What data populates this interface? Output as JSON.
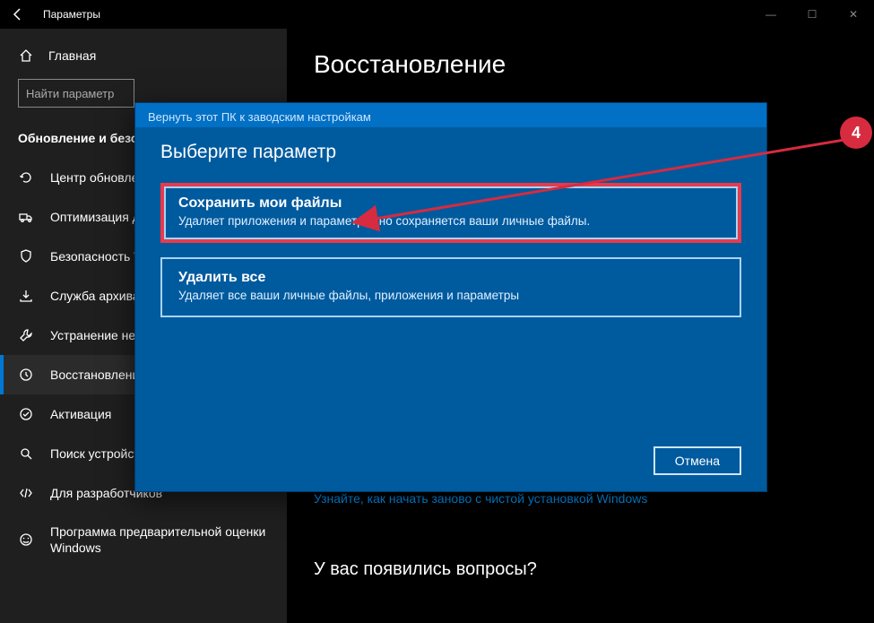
{
  "window": {
    "title": "Параметры",
    "minimize": "—",
    "maximize": "☐",
    "close": "✕"
  },
  "sidebar": {
    "home_label": "Главная",
    "search_placeholder": "Найти параметр",
    "section_title": "Обновление и безопасность",
    "items": [
      {
        "icon": "refresh-icon",
        "label": "Центр обновления Windows"
      },
      {
        "icon": "truck-icon",
        "label": "Оптимизация доставки"
      },
      {
        "icon": "shield-icon",
        "label": "Безопасность Windows"
      },
      {
        "icon": "backup-icon",
        "label": "Служба архивации"
      },
      {
        "icon": "wrench-icon",
        "label": "Устранение неполадок"
      },
      {
        "icon": "recovery-icon",
        "label": "Восстановление",
        "selected": true
      },
      {
        "icon": "activation-icon",
        "label": "Активация"
      },
      {
        "icon": "find-icon",
        "label": "Поиск устройства"
      },
      {
        "icon": "devmode-icon",
        "label": "Для разработчиков"
      },
      {
        "icon": "insider-icon",
        "label": "Программа предварительной оценки",
        "label2": "Windows"
      }
    ]
  },
  "main": {
    "page_title": "Восстановление",
    "link_text": "Узнайте, как начать заново с чистой установкой Windows",
    "faq_heading": "У вас появились вопросы?"
  },
  "dialog": {
    "title": "Вернуть этот ПК к заводским настройкам",
    "heading": "Выберите параметр",
    "options": [
      {
        "title": "Сохранить мои файлы",
        "desc": "Удаляет приложения и параметры, но сохраняется ваши личные файлы.",
        "highlight": true
      },
      {
        "title": "Удалить все",
        "desc": "Удаляет все ваши личные файлы, приложения и параметры"
      }
    ],
    "cancel_label": "Отмена"
  },
  "annotation": {
    "number": "4"
  }
}
